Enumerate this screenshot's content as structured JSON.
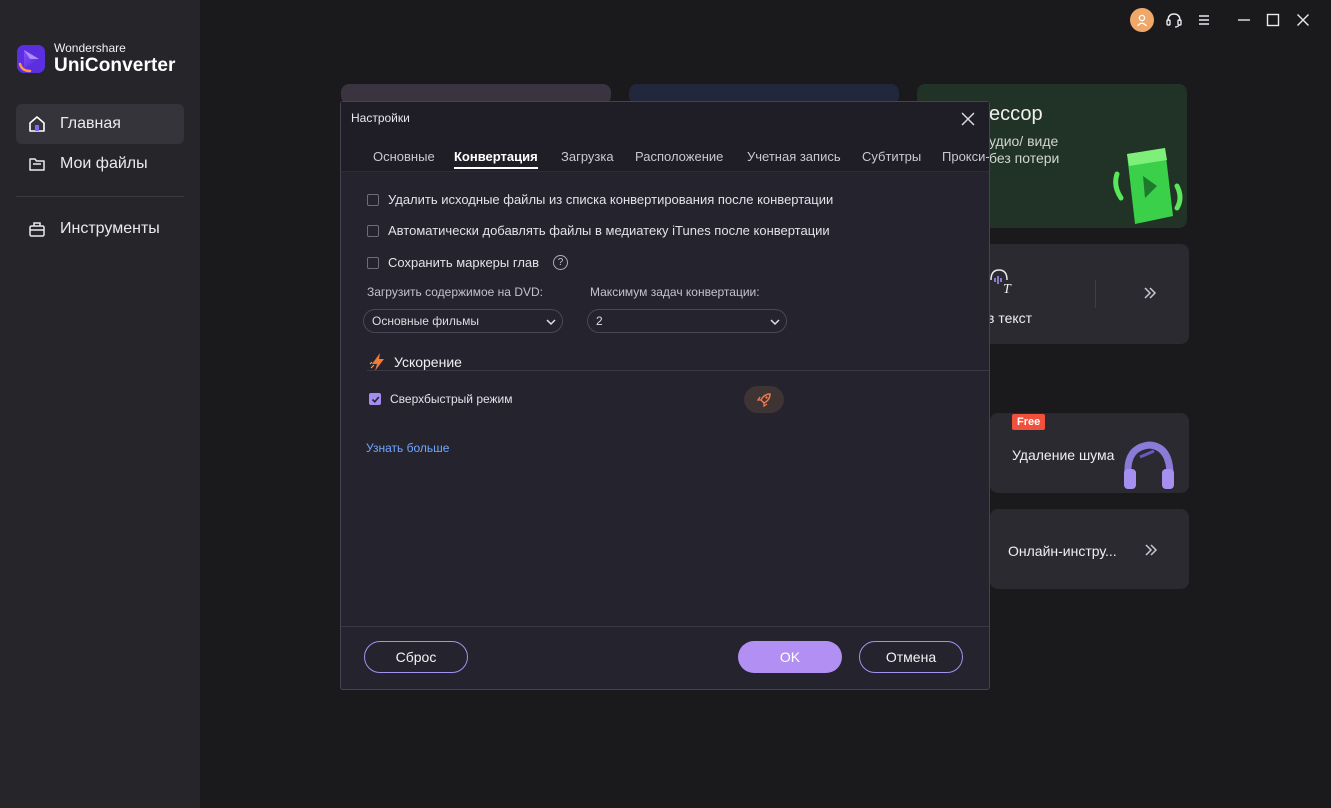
{
  "app": {
    "brand_small": "Wondershare",
    "brand_big": "UniConverter"
  },
  "sidebar": {
    "items": [
      {
        "label": "Главная",
        "icon": "home-icon",
        "active": true
      },
      {
        "label": "Мои файлы",
        "icon": "folder-icon",
        "active": false
      },
      {
        "label": "Инструменты",
        "icon": "toolbox-icon",
        "active": false
      }
    ]
  },
  "background_cards": {
    "compressor_title": "ессор",
    "compressor_desc_1": "удио/ виде",
    "compressor_desc_2": "без потери",
    "speech_text": "в текст",
    "speech_icon_text": "T",
    "noise_badge": "Free",
    "noise_label": "Удаление шума",
    "online_label": "Онлайн-инстру..."
  },
  "dialog": {
    "title": "Настройки",
    "tabs": [
      "Основные",
      "Конвертация",
      "Загрузка",
      "Расположение",
      "Учетная запись",
      "Субтитры",
      "Прокси-"
    ],
    "active_tab": "Конвертация",
    "options": [
      {
        "label": "Удалить исходные файлы из списка конвертирования после конвертации",
        "checked": false
      },
      {
        "label": "Автоматически добавлять файлы в медиатеку iTunes после конвертации",
        "checked": false
      },
      {
        "label": "Сохранить маркеры глав",
        "checked": false
      }
    ],
    "help_glyph": "?",
    "dvd_label": "Загрузить содержимое на DVD:",
    "dvd_value": "Основные фильмы",
    "max_tasks_label": "Максимум задач конвертации:",
    "max_tasks_value": "2",
    "acceleration_title": "Ускорение",
    "turbo_label": "Сверхбыстрый режим",
    "turbo_checked": true,
    "learn_more": "Узнать больше",
    "reset_label": "Сброс",
    "ok_label": "OK",
    "cancel_label": "Отмена"
  },
  "colors": {
    "accent": "#b28ff3",
    "link": "#6fa7ff",
    "green_card": "#213326"
  }
}
